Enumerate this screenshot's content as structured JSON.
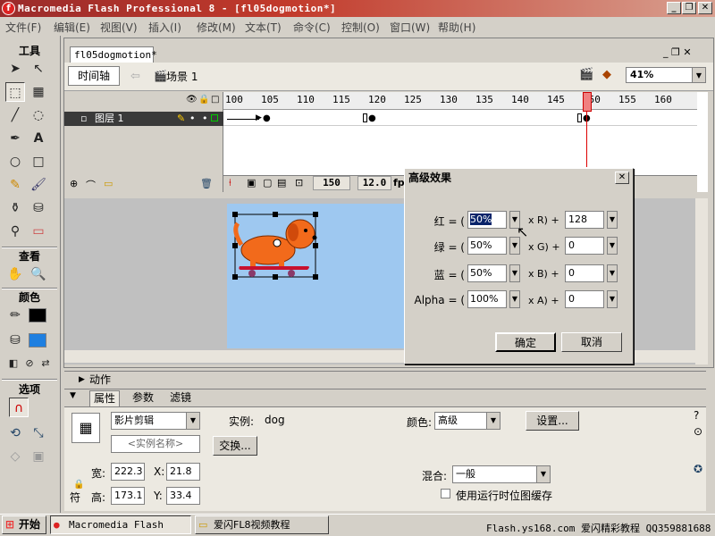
{
  "app": {
    "title": "Macromedia Flash Professional 8 - [fl05dogmotion*]",
    "window_buttons": [
      "_",
      "❐",
      "✕"
    ]
  },
  "menu": [
    "文件(F)",
    "编辑(E)",
    "视图(V)",
    "插入(I)",
    "修改(M)",
    "文本(T)",
    "命令(C)",
    "控制(O)",
    "窗口(W)",
    "帮助(H)"
  ],
  "toolbox": {
    "tools_label": "工具",
    "view_label": "查看",
    "colors_label": "颜色",
    "options_label": "选项"
  },
  "document": {
    "tab": "fl05dogmotion*",
    "timeline_button": "时间轴",
    "scene": "场景 1",
    "zoom": "41%"
  },
  "timeline": {
    "ruler": [
      "100",
      "105",
      "110",
      "115",
      "120",
      "125",
      "130",
      "135",
      "140",
      "145",
      "150",
      "155",
      "160"
    ],
    "layer_name": "图层 1",
    "current_frame": "150",
    "fps": "12.0",
    "fps_unit": "fps"
  },
  "panels": {
    "actions_label": "动作",
    "tabs": [
      "属性",
      "参数",
      "滤镜"
    ],
    "symbol_type": "影片剪辑",
    "instance_name_placeholder": "<实例名称>",
    "instance_label": "实例:",
    "instance_value": "dog",
    "swap_button": "交换...",
    "color_label": "颜色:",
    "color_value": "高级",
    "settings_button": "设置...",
    "width_label": "宽:",
    "width_value": "222.3",
    "height_label": "高:",
    "height_value": "173.1",
    "x_label": "X:",
    "x_value": "21.8",
    "y_label": "Y:",
    "y_value": "33.4",
    "blend_label": "混合:",
    "blend_value": "一般",
    "cache_checkbox_label": "使用运行时位图缓存",
    "lock_label": "符"
  },
  "dialog": {
    "title": "高级效果",
    "rows": [
      {
        "label": "红 = (",
        "percent": "50%",
        "mid": "x R) +",
        "offset": "128"
      },
      {
        "label": "绿 = (",
        "percent": "50%",
        "mid": "x G) +",
        "offset": "0"
      },
      {
        "label": "蓝 = (",
        "percent": "50%",
        "mid": "x B) +",
        "offset": "0"
      },
      {
        "label": "Alpha = (",
        "percent": "100%",
        "mid": "x A) +",
        "offset": "0"
      }
    ],
    "ok_button": "确定",
    "cancel_button": "取消"
  },
  "taskbar": {
    "start": "开始",
    "tasks": [
      "Macromedia Flash Pr...",
      "爱闪FL8视频教程"
    ],
    "tray": "Flash.ys168.com 爱闪精彩教程 QQ359881688"
  },
  "colors": {
    "stage": "#9ec8f0",
    "dog": "#f26a1b",
    "titlebar": "#c23a2b"
  }
}
